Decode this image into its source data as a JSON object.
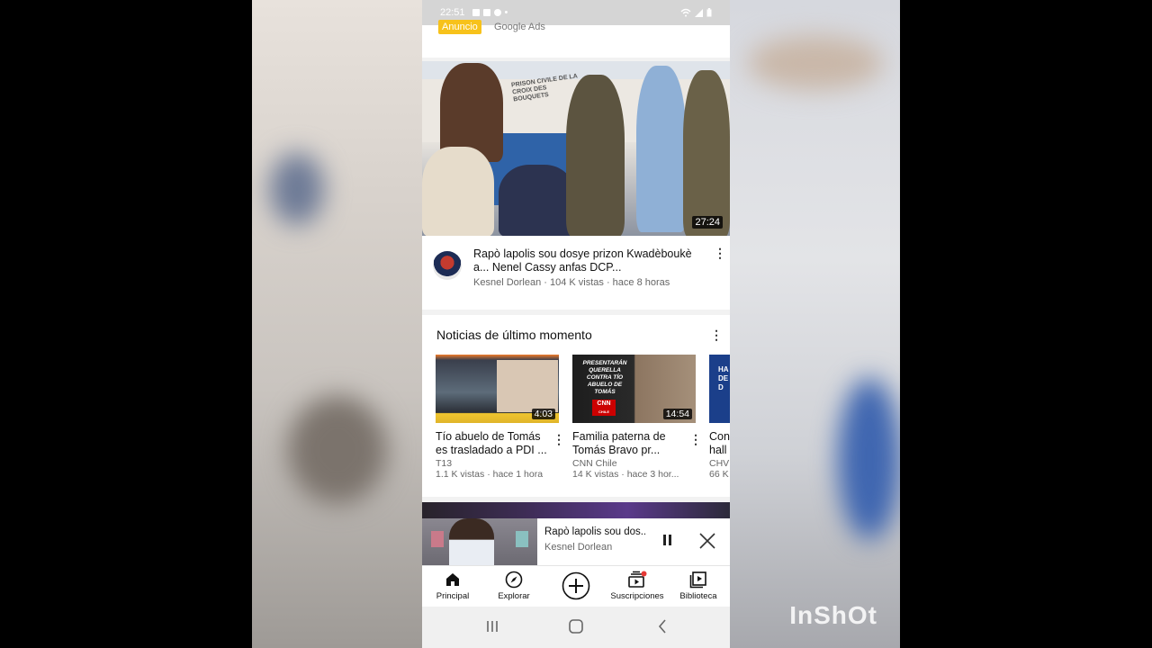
{
  "statusbar": {
    "time": "22:51"
  },
  "ad": {
    "badge": "Anuncio",
    "source": "Google Ads"
  },
  "featured_video": {
    "thumb_text": "PRISON CIVILE DE LA CROIX DES BOUQUETS",
    "duration": "27:24",
    "title": "Rapò lapolis sou dosye prizon Kwadèboukè a... Nenel Cassy anfas DCP...",
    "channel_stats": "Kesnel Dorlean · 104 K vistas · hace 8 horas",
    "menu_icon": "kebab-icon"
  },
  "news": {
    "heading": "Noticias de último momento",
    "items": [
      {
        "duration": "4:03",
        "title": "Tío abuelo de Tomás es trasladado a PDI ...",
        "channel": "T13",
        "stats": "1.1 K vistas · hace 1 hora"
      },
      {
        "duration": "14:54",
        "thumb_text": "PRESENTARÁN QUERELLA CONTRA TÍO ABUELO DE TOMÁS",
        "thumb_logo": "CNN",
        "thumb_logo_sub": "CHILE",
        "title": "Familia paterna de Tomás Bravo pr...",
        "channel": "CNN Chile",
        "stats": "14 K vistas · hace 3 hor..."
      },
      {
        "thumb_text": "HA DE D",
        "title": "Con hall",
        "channel": "CHV",
        "stats": "66 K"
      }
    ]
  },
  "miniplayer": {
    "title": "Rapò lapolis sou dos...",
    "channel": "Kesnel Dorlean"
  },
  "bottom_nav": [
    {
      "label": "Principal",
      "icon": "home-icon"
    },
    {
      "label": "Explorar",
      "icon": "compass-icon"
    },
    {
      "label": "",
      "icon": "create-plus-icon"
    },
    {
      "label": "Suscripciones",
      "icon": "subscriptions-icon"
    },
    {
      "label": "Biblioteca",
      "icon": "library-icon"
    }
  ],
  "watermark": "InShOt",
  "colors": {
    "ad_badge": "#f7c21b",
    "notification_dot": "#e53935"
  }
}
